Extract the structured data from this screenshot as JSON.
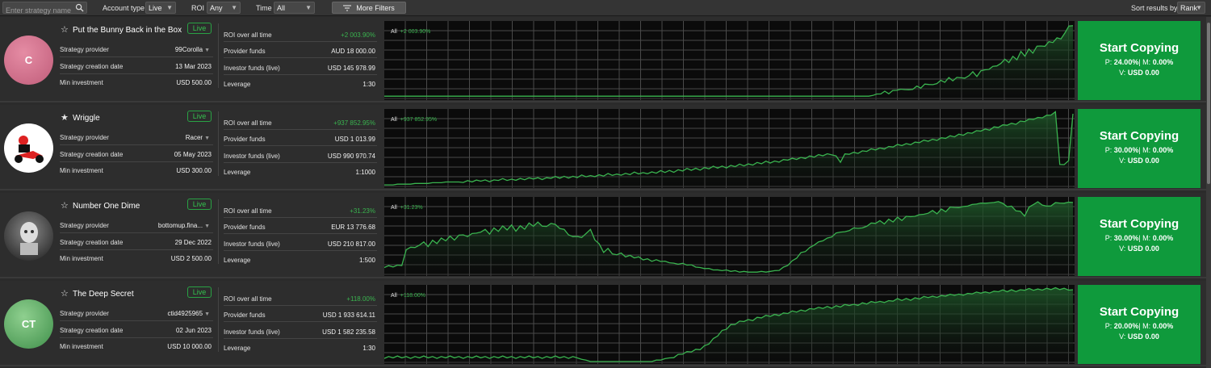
{
  "toolbar": {
    "search_placeholder": "Enter strategy name",
    "account_type_label": "Account type",
    "account_type_value": "Live",
    "roi_label": "ROI",
    "roi_value": "Any",
    "time_label": "Time",
    "time_value": "All",
    "more_filters": "More Filters",
    "sort_label": "Sort results by",
    "sort_value": "Rank"
  },
  "labels": {
    "provider": "Strategy provider",
    "creation": "Strategy creation date",
    "min_invest": "Min investment",
    "roi": "ROI over all time",
    "provider_funds": "Provider funds",
    "investor_funds": "Investor funds (live)",
    "leverage": "Leverage",
    "live": "Live",
    "chart_period": "All",
    "cta": "Start Copying",
    "p": "P:",
    "m": "M:",
    "v": "V:"
  },
  "strategies": [
    {
      "name": "Put the Bunny Back in the Box",
      "avatar_text": "C",
      "favorite": false,
      "provider": "99Corolla",
      "creation_date": "13 Mar 2023",
      "min_investment": "USD 500.00",
      "roi": "+2 003.90%",
      "provider_funds": "AUD 18 000.00",
      "investor_funds": "USD 145 978.99",
      "leverage": "1:30",
      "p": "24.00%",
      "m": "0.00%",
      "v": "USD 0.00"
    },
    {
      "name": "Wriggle",
      "avatar_text": "",
      "favorite": true,
      "provider": "Racer",
      "creation_date": "05 May 2023",
      "min_investment": "USD 300.00",
      "roi": "+937 852.95%",
      "provider_funds": "USD 1 013.99",
      "investor_funds": "USD 990 970.74",
      "leverage": "1:1000",
      "p": "30.00%",
      "m": "0.00%",
      "v": "USD 0.00"
    },
    {
      "name": "Number One Dime",
      "avatar_text": "",
      "favorite": false,
      "provider": "bottomup.fina...",
      "creation_date": "29 Dec 2022",
      "min_investment": "USD 2 500.00",
      "roi": "+31.23%",
      "provider_funds": "EUR 13 776.68",
      "investor_funds": "USD 210 817.00",
      "leverage": "1:500",
      "p": "30.00%",
      "m": "0.00%",
      "v": "USD 0.00"
    },
    {
      "name": "The Deep Secret",
      "avatar_text": "CT",
      "favorite": false,
      "provider": "ctid4925965",
      "creation_date": "02 Jun 2023",
      "min_investment": "USD 10 000.00",
      "roi": "+118.00%",
      "provider_funds": "USD 1 933 614.11",
      "investor_funds": "USD 1 582 235.58",
      "leverage": "1:30",
      "p": "20.00%",
      "m": "0.00%",
      "v": "USD 0.00"
    }
  ],
  "colors": {
    "accent_green": "#3ab34f",
    "cta_green": "#0f9a3c"
  }
}
